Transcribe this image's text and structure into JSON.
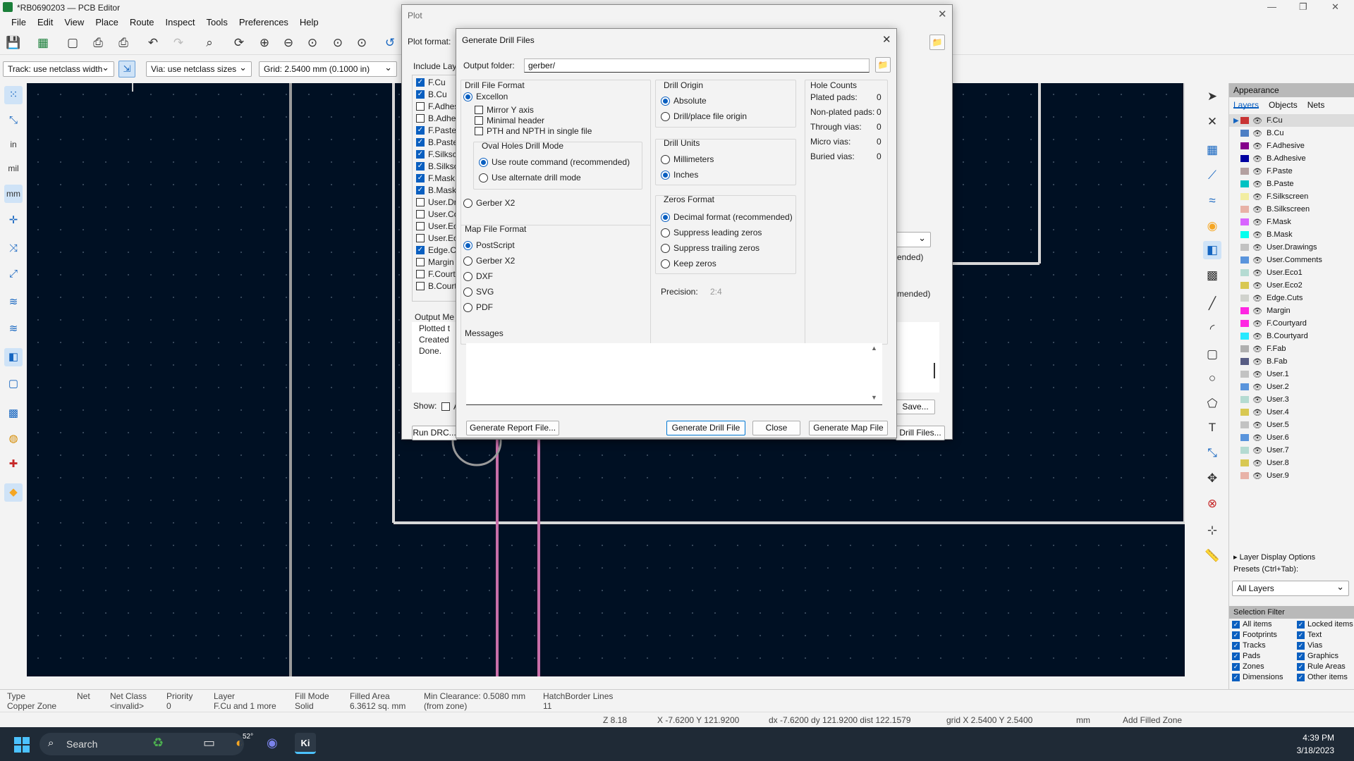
{
  "window": {
    "title": "*RB0690203 — PCB Editor"
  },
  "menu": [
    "File",
    "Edit",
    "View",
    "Place",
    "Route",
    "Inspect",
    "Tools",
    "Preferences",
    "Help"
  ],
  "toolbar2": {
    "track": "Track: use netclass width",
    "via": "Via: use netclass sizes",
    "grid": "Grid: 2.5400 mm (0.1000 in)"
  },
  "plot": {
    "title": "Plot",
    "plot_format_label": "Plot format:",
    "include_layers_label": "Include Lay",
    "layers": [
      {
        "label": "F.Cu",
        "checked": true
      },
      {
        "label": "B.Cu",
        "checked": true
      },
      {
        "label": "F.Adhes",
        "checked": false
      },
      {
        "label": "B.Adhes",
        "checked": false
      },
      {
        "label": "F.Paste",
        "checked": true
      },
      {
        "label": "B.Paste",
        "checked": true
      },
      {
        "label": "F.Silkscr",
        "checked": true
      },
      {
        "label": "B.Silksc",
        "checked": true
      },
      {
        "label": "F.Mask",
        "checked": true
      },
      {
        "label": "B.Mask",
        "checked": true
      },
      {
        "label": "User.Dra",
        "checked": false
      },
      {
        "label": "User.Co",
        "checked": false
      },
      {
        "label": "User.Ec",
        "checked": false
      },
      {
        "label": "User.Ec",
        "checked": false
      },
      {
        "label": "Edge.Cu",
        "checked": true
      },
      {
        "label": "Margin",
        "checked": false
      },
      {
        "label": "F.Court",
        "checked": false
      },
      {
        "label": "B.Court",
        "checked": false
      }
    ],
    "output_messages_label": "Output Me",
    "messages_lines": [
      "Plotted t",
      "Created",
      "Done."
    ],
    "show_label": "Show:",
    "show_opt": "A",
    "right_frag1": "ended)",
    "right_frag2": "mmended)",
    "save_btn": "Save...",
    "run_drc_btn": "Run DRC...",
    "drill_files_btn": "Drill Files..."
  },
  "drill": {
    "title": "Generate Drill Files",
    "output_folder_label": "Output folder:",
    "output_folder_value": "gerber/",
    "drill_file_format": {
      "title": "Drill File Format",
      "excellon": "Excellon",
      "mirror_y": "Mirror Y axis",
      "minimal_header": "Minimal header",
      "pth_npth": "PTH and NPTH in single file",
      "gerber_x2": "Gerber X2"
    },
    "oval_holes": {
      "title": "Oval Holes Drill Mode",
      "route": "Use route command (recommended)",
      "alternate": "Use alternate drill mode"
    },
    "map_file_format": {
      "title": "Map File Format",
      "options": [
        {
          "label": "PostScript",
          "on": true
        },
        {
          "label": "Gerber X2",
          "on": false
        },
        {
          "label": "DXF",
          "on": false
        },
        {
          "label": "SVG",
          "on": false
        },
        {
          "label": "PDF",
          "on": false
        }
      ]
    },
    "drill_origin": {
      "title": "Drill Origin",
      "absolute": "Absolute",
      "aux": "Drill/place file origin"
    },
    "drill_units": {
      "title": "Drill Units",
      "mm": "Millimeters",
      "in": "Inches"
    },
    "zeros_format": {
      "title": "Zeros Format",
      "options": [
        {
          "label": "Decimal format (recommended)",
          "on": true
        },
        {
          "label": "Suppress leading zeros",
          "on": false
        },
        {
          "label": "Suppress trailing zeros",
          "on": false
        },
        {
          "label": "Keep zeros",
          "on": false
        }
      ]
    },
    "precision_label": "Precision:",
    "precision_value": "2:4",
    "hole_counts": {
      "title": "Hole Counts",
      "rows": [
        {
          "label": "Plated pads:",
          "value": "0"
        },
        {
          "label": "Non-plated pads:",
          "value": "0"
        },
        {
          "label": "Through vias:",
          "value": "0"
        },
        {
          "label": "Micro vias:",
          "value": "0"
        },
        {
          "label": "Buried vias:",
          "value": "0"
        }
      ]
    },
    "messages_title": "Messages",
    "buttons": {
      "report": "Generate Report File...",
      "drill": "Generate Drill File",
      "close": "Close",
      "map": "Generate Map File"
    }
  },
  "appearance": {
    "title": "Appearance",
    "tabs": [
      "Layers",
      "Objects",
      "Nets"
    ],
    "layers": [
      {
        "name": "F.Cu",
        "color": "#c83434"
      },
      {
        "name": "B.Cu",
        "color": "#4d7fc4"
      },
      {
        "name": "F.Adhesive",
        "color": "#84008a"
      },
      {
        "name": "B.Adhesive",
        "color": "#0000a0"
      },
      {
        "name": "F.Paste",
        "color": "#b4a0a0"
      },
      {
        "name": "B.Paste",
        "color": "#00c2c2"
      },
      {
        "name": "F.Silkscreen",
        "color": "#f2eda1"
      },
      {
        "name": "B.Silkscreen",
        "color": "#e8b2a7"
      },
      {
        "name": "F.Mask",
        "color": "#d864ff"
      },
      {
        "name": "B.Mask",
        "color": "#02ffee"
      },
      {
        "name": "User.Drawings",
        "color": "#c2c2c2"
      },
      {
        "name": "User.Comments",
        "color": "#5994dc"
      },
      {
        "name": "User.Eco1",
        "color": "#b4dbd2"
      },
      {
        "name": "User.Eco2",
        "color": "#d8c852"
      },
      {
        "name": "Edge.Cuts",
        "color": "#d0d2cd"
      },
      {
        "name": "Margin",
        "color": "#ff26e2"
      },
      {
        "name": "F.Courtyard",
        "color": "#ff26e2"
      },
      {
        "name": "B.Courtyard",
        "color": "#26e9ff"
      },
      {
        "name": "F.Fab",
        "color": "#afafaf"
      },
      {
        "name": "B.Fab",
        "color": "#585d84"
      },
      {
        "name": "User.1",
        "color": "#c2c2c2"
      },
      {
        "name": "User.2",
        "color": "#5994dc"
      },
      {
        "name": "User.3",
        "color": "#b4dbd2"
      },
      {
        "name": "User.4",
        "color": "#d8c852"
      },
      {
        "name": "User.5",
        "color": "#c2c2c2"
      },
      {
        "name": "User.6",
        "color": "#5994dc"
      },
      {
        "name": "User.7",
        "color": "#b4dbd2"
      },
      {
        "name": "User.8",
        "color": "#d8c852"
      },
      {
        "name": "User.9",
        "color": "#e8b2a7"
      }
    ],
    "layer_display_options": "Layer Display Options",
    "presets_label": "Presets (Ctrl+Tab):",
    "presets_value": "All Layers",
    "selection_filter": "Selection Filter",
    "filters_left": [
      "All items",
      "Footprints",
      "Tracks",
      "Pads",
      "Zones",
      "Dimensions"
    ],
    "filters_right": [
      "Locked items",
      "Text",
      "Vias",
      "Graphics",
      "Rule Areas",
      "Other items"
    ]
  },
  "status": {
    "cols": [
      {
        "h": "Type",
        "v": "Copper Zone"
      },
      {
        "h": "Net",
        "v": ""
      },
      {
        "h": "Net Class",
        "v": "<invalid>"
      },
      {
        "h": "Priority",
        "v": "0"
      },
      {
        "h": "Layer",
        "v": "F.Cu and 1 more"
      },
      {
        "h": "Fill Mode",
        "v": "Solid"
      },
      {
        "h": "Filled Area",
        "v": "6.3612 sq. mm"
      },
      {
        "h": "Min Clearance: 0.5080 mm",
        "v": "(from zone)"
      },
      {
        "h": "HatchBorder Lines",
        "v": "11"
      }
    ],
    "z": "Z 8.18",
    "xy": "X -7.6200  Y 121.9200",
    "dxy": "dx -7.6200  dy 121.9200  dist 122.1579",
    "grid": "grid X 2.5400  Y 2.5400",
    "units": "mm",
    "mode": "Add Filled Zone"
  },
  "taskbar": {
    "search": "Search",
    "weather": "52°",
    "time": "4:39 PM",
    "date": "3/18/2023"
  }
}
